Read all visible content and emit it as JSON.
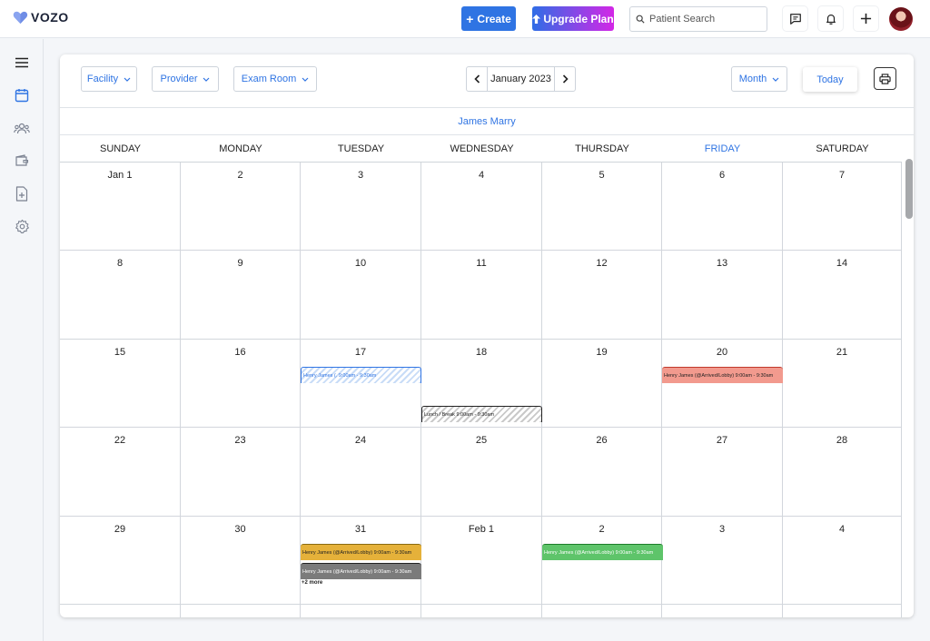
{
  "app": {
    "brand": "VOZO"
  },
  "header": {
    "create_label": "Create",
    "upgrade_label": "Upgrade Plan",
    "search_placeholder": "Patient Search",
    "colors": {
      "create": "#2f74e3",
      "upgrade_start": "#2f6de6",
      "upgrade_end": "#d327e6"
    }
  },
  "sidebar": {
    "items": [
      "menu-icon",
      "calendar-icon",
      "patients-icon",
      "wallet-icon",
      "add-document-icon",
      "settings-icon"
    ]
  },
  "toolbar": {
    "facility": "Facility",
    "provider": "Provider",
    "exam_room": "Exam Room",
    "current_month": "January 2023",
    "view": "Month",
    "today_label": "Today"
  },
  "calendar": {
    "provider_name": "James Marry",
    "weekdays": [
      "SUNDAY",
      "MONDAY",
      "TUESDAY",
      "WEDNESDAY",
      "THURSDAY",
      "FRIDAY",
      "SATURDAY"
    ],
    "highlight_weekday": "FRIDAY",
    "weeks": [
      [
        "Jan 1",
        "2",
        "3",
        "4",
        "5",
        "6",
        "7"
      ],
      [
        "8",
        "9",
        "10",
        "11",
        "12",
        "13",
        "14"
      ],
      [
        "15",
        "16",
        "17",
        "18",
        "19",
        "20",
        "21"
      ],
      [
        "22",
        "23",
        "24",
        "25",
        "26",
        "27",
        "28"
      ],
      [
        "29",
        "30",
        "31",
        "Feb 1",
        "2",
        "3",
        "4"
      ]
    ],
    "events": [
      {
        "text": "Henry James (.  9:00am - 9:30am",
        "week": 2,
        "day": 2,
        "slot": 0,
        "style": "blue-hatch"
      },
      {
        "text": "Henry James (@Arrived/Lobby)  9:00am - 9:30am",
        "week": 2,
        "day": 5,
        "slot": 0,
        "style": "salmon"
      },
      {
        "text": "Lunch / Break  9:00am - 9:30am",
        "week": 2,
        "day": 3,
        "slot": 2,
        "style": "gray-hatch"
      },
      {
        "text": "Henry James (@Arrived/Lobby)  9:00am - 9:30am",
        "week": 4,
        "day": 2,
        "slot": 0,
        "style": "amber"
      },
      {
        "text": "Henry James (@Arrived/Lobby)  9:00am - 9:30am",
        "week": 4,
        "day": 2,
        "slot": 1,
        "style": "gray"
      },
      {
        "text": "Henry James (@Arrived/Lobby)  9:00am - 9:30am",
        "week": 4,
        "day": 4,
        "slot": 0,
        "style": "green"
      }
    ],
    "more": {
      "text": "+2 more",
      "week": 4,
      "day": 2
    }
  },
  "colors": {
    "accent": "#2f74e3",
    "salmon": "#f29a8e",
    "amber": "#e5b13a",
    "gray_event": "#7b7b7b",
    "green": "#5ec46a"
  }
}
